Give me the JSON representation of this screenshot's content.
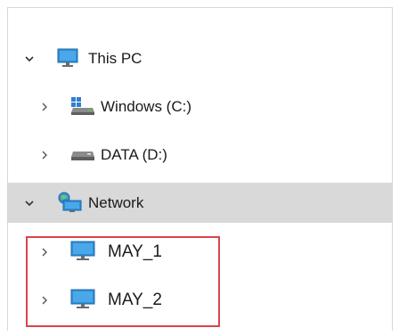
{
  "tree": {
    "this_pc": {
      "label": "This PC",
      "icon": "monitor-icon",
      "expanded": true
    },
    "drive_c": {
      "label": "Windows (C:)",
      "icon": "windows-drive-icon",
      "expanded": false
    },
    "drive_d": {
      "label": "DATA (D:)",
      "icon": "drive-icon",
      "expanded": false
    },
    "network": {
      "label": "Network",
      "icon": "network-icon",
      "expanded": true,
      "selected": true
    },
    "computers": [
      {
        "label": "MAY_1",
        "icon": "computer-icon",
        "expanded": false
      },
      {
        "label": "MAY_2",
        "icon": "computer-icon",
        "expanded": false
      }
    ]
  },
  "colors": {
    "selection": "#d9d9d9",
    "highlight_border": "#d9454a",
    "monitor": "#2f8fd6"
  }
}
